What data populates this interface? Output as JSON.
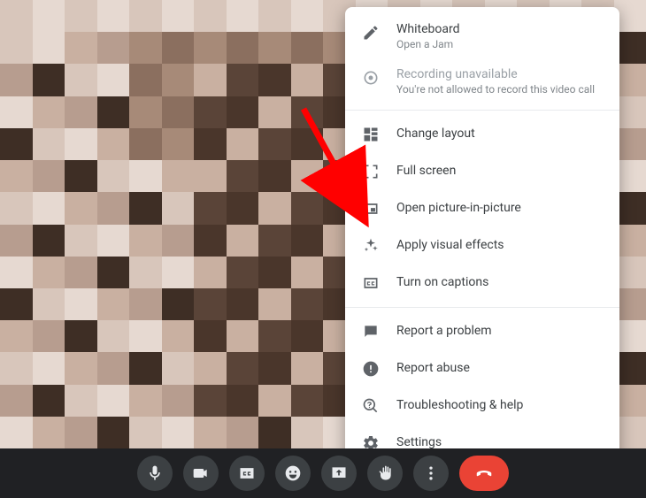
{
  "menu": {
    "whiteboard": {
      "label": "Whiteboard",
      "sub": "Open a Jam"
    },
    "recording": {
      "label": "Recording unavailable",
      "sub": "You're not allowed to record this video call"
    },
    "layout": {
      "label": "Change layout"
    },
    "fullscreen": {
      "label": "Full screen"
    },
    "pip": {
      "label": "Open picture-in-picture"
    },
    "effects": {
      "label": "Apply visual effects"
    },
    "captions": {
      "label": "Turn on captions"
    },
    "report": {
      "label": "Report a problem"
    },
    "abuse": {
      "label": "Report abuse"
    },
    "trouble": {
      "label": "Troubleshooting & help"
    },
    "settings": {
      "label": "Settings"
    }
  },
  "bg_palette": [
    "#a78a78",
    "#8b6f5f",
    "#6e5547",
    "#5a4438",
    "#4a362b",
    "#c9b0a1",
    "#b79d8f",
    "#3e2e25",
    "#d8c6bb",
    "#e6d9d1",
    "#997e6e",
    "#7c6254",
    "#311f17",
    "#251611"
  ]
}
